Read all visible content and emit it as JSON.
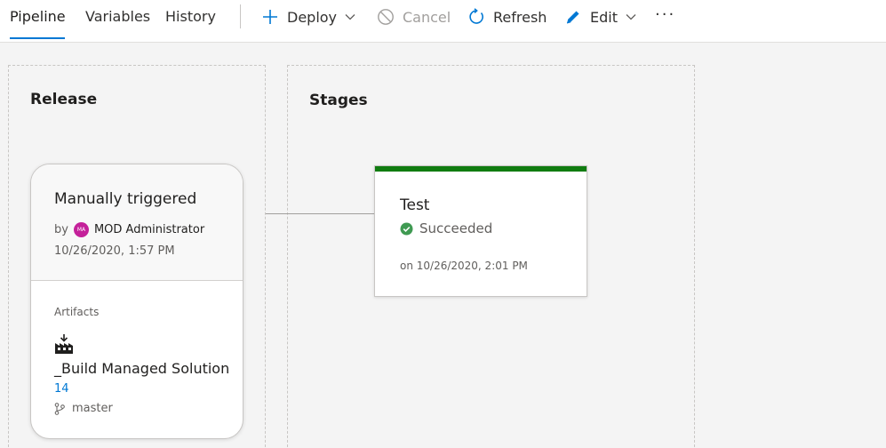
{
  "toolbar": {
    "tabs": [
      {
        "label": "Pipeline",
        "active": true
      },
      {
        "label": "Variables",
        "active": false
      },
      {
        "label": "History",
        "active": false
      }
    ],
    "commands": {
      "deploy": {
        "label": "Deploy",
        "icon": "plus-icon"
      },
      "cancel": {
        "label": "Cancel",
        "icon": "cancel-icon",
        "disabled": true
      },
      "refresh": {
        "label": "Refresh",
        "icon": "refresh-icon"
      },
      "edit": {
        "label": "Edit",
        "icon": "pencil-icon"
      },
      "more": {
        "label": "···",
        "icon": "more-icon"
      }
    }
  },
  "release": {
    "title": "Release",
    "trigger": "Manually triggered",
    "by_prefix": "by",
    "avatar_initials": "MA",
    "user": "MOD Administrator",
    "date": "10/26/2020, 1:57 PM",
    "artifacts_label": "Artifacts",
    "artifact": {
      "name": "_Build Managed Solution",
      "version": "14",
      "branch": "master"
    }
  },
  "stages": {
    "title": "Stages",
    "items": [
      {
        "name": "Test",
        "status": "Succeeded",
        "date": "on 10/26/2020, 2:01 PM"
      }
    ]
  },
  "colors": {
    "accent": "#0078d4",
    "success": "#107c10",
    "avatar": "#c4219a"
  }
}
